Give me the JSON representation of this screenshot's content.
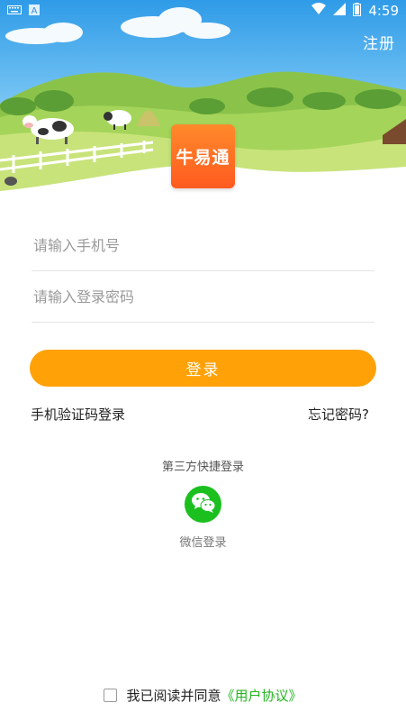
{
  "status_bar": {
    "time": "4:59",
    "icons": [
      "keyboard-icon",
      "notification-a-icon",
      "wifi-icon",
      "signal-icon",
      "battery-icon"
    ]
  },
  "header": {
    "register_label": "注册",
    "logo_text": "牛易通"
  },
  "form": {
    "phone_placeholder": "请输入手机号",
    "password_placeholder": "请输入登录密码",
    "login_label": "登录",
    "sms_login_label": "手机验证码登录",
    "forgot_password_label": "忘记密码?"
  },
  "third_party": {
    "title": "第三方快捷登录",
    "wechat_label": "微信登录",
    "wechat_icon": "wechat-icon"
  },
  "agreement": {
    "text": "我已阅读并同意",
    "link": "《用户协议》"
  },
  "colors": {
    "accent": "#ffa107",
    "logo_orange": "#ff6a22",
    "wechat_green": "#1bc01e",
    "link_green": "#22b51f"
  }
}
